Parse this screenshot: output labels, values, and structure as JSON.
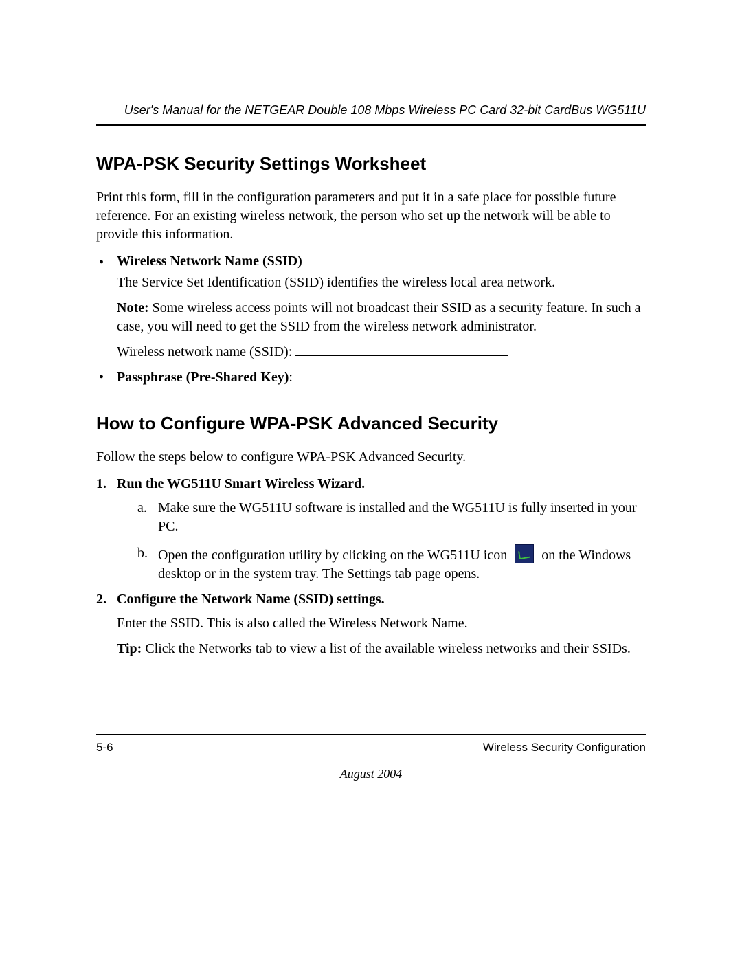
{
  "header": {
    "running": "User's Manual for the NETGEAR Double 108 Mbps Wireless PC Card 32-bit CardBus WG511U"
  },
  "section1": {
    "title": "WPA-PSK Security Settings Worksheet",
    "intro": "Print this form, fill in the configuration parameters and put it in a safe place for possible future reference. For an existing wireless network, the person who set up the network will be able to provide this information.",
    "bullet1": {
      "head": "Wireless Network Name (SSID)",
      "body1": "The Service Set Identification (SSID) identifies the wireless local area network.",
      "note_label": "Note:",
      "note_body": " Some wireless access points will not broadcast their SSID as a security feature. In such a case, you will need to get the SSID from the wireless network administrator.",
      "fill_label": "Wireless network name (SSID): "
    },
    "bullet2": {
      "head": "Passphrase (Pre-Shared Key)",
      "colon": ": "
    }
  },
  "section2": {
    "title": "How to Configure WPA-PSK Advanced Security",
    "intro": "Follow the steps below to configure WPA-PSK Advanced Security.",
    "step1": {
      "head": "Run the WG511U Smart Wireless Wizard.",
      "a": "Make sure the WG511U software is installed and the WG511U is fully inserted in your PC.",
      "b_pre": "Open the configuration utility by clicking on the WG511U icon",
      "b_post": "on the Windows desktop or in the system tray. The Settings tab page opens."
    },
    "step2": {
      "head": "Configure the Network Name (SSID) settings.",
      "body": "Enter the SSID. This is also called the Wireless Network Name.",
      "tip_label": "Tip:",
      "tip_body": " Click the Networks tab to view a list of the available wireless networks and their SSIDs."
    }
  },
  "footer": {
    "page": "5-6",
    "section": "Wireless Security Configuration",
    "date": "August 2004"
  }
}
